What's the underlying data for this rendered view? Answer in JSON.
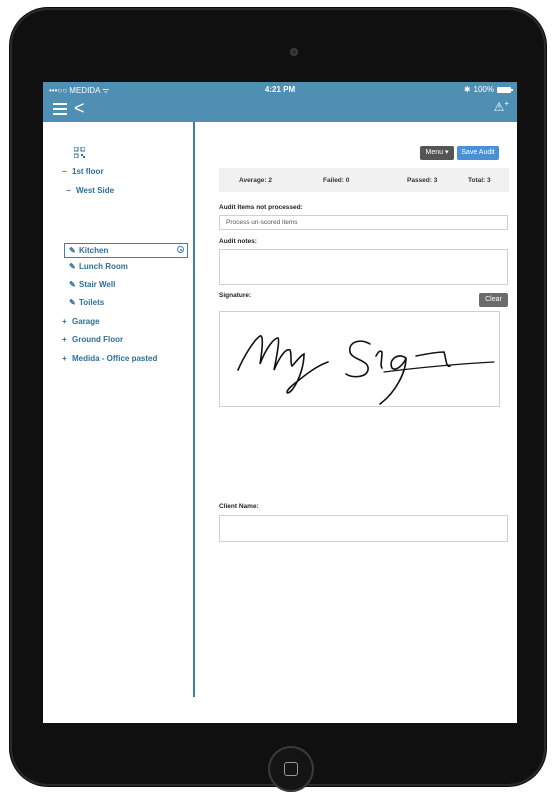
{
  "status_bar": {
    "carrier": "•••○○ MEDIDA ᯤ",
    "time": "4:21 PM",
    "bluetooth": "✱",
    "battery": "100%"
  },
  "header": {
    "menu_icon": "hamburger-icon",
    "back_icon": "chevron-left-icon",
    "action_icon": "add-alert-icon",
    "action_glyph": "⚠",
    "action_plus": "+"
  },
  "sidebar": {
    "items": [
      {
        "icon": "−",
        "label": "1st floor"
      },
      {
        "icon": "−",
        "label": "West Side"
      },
      {
        "icon": "✎",
        "label": "Kitchen",
        "selected": true
      },
      {
        "icon": "✎",
        "label": "Lunch Room"
      },
      {
        "icon": "✎",
        "label": "Stair Well"
      },
      {
        "icon": "✎",
        "label": "Toilets"
      },
      {
        "icon": "+",
        "label": "Garage"
      },
      {
        "icon": "+",
        "label": "Ground Floor"
      },
      {
        "icon": "+",
        "label": "Medida - Office pasted"
      }
    ]
  },
  "toolbar": {
    "menu_label": "Menu ▾",
    "save_label": "Save Audit"
  },
  "stats": {
    "average": "Average: 2",
    "failed": "Failed: 0",
    "passed": "Passed: 3",
    "total": "Total: 3"
  },
  "form": {
    "unprocessed_label": "Audit Items not processed:",
    "unprocessed_value": "Process un-scored items",
    "notes_label": "Audit notes:",
    "notes_value": "",
    "signature_label": "Signature:",
    "clear_label": "Clear",
    "client_label": "Client Name:",
    "client_value": ""
  },
  "colors": {
    "header": "#4f8fb3",
    "accent": "#2d6f98",
    "save_button": "#4a90d9"
  }
}
